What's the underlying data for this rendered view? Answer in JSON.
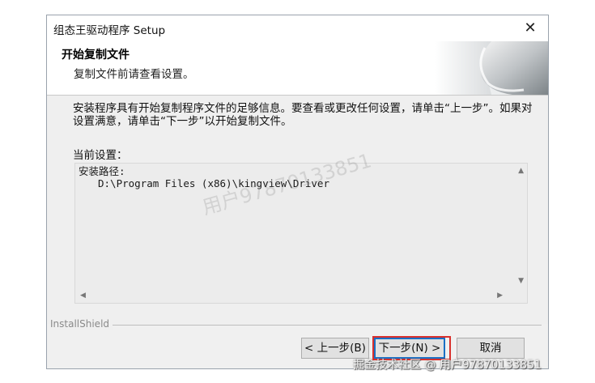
{
  "window": {
    "title": "组态王驱动程序 Setup",
    "close_glyph": "✕"
  },
  "header": {
    "title": "开始复制文件",
    "subtitle": "复制文件前请查看设置。"
  },
  "body": {
    "description": "安装程序具有开始复制程序文件的足够信息。要查看或更改任何设置，请单击“上一步”。如果对设置满意，请单击“下一步”以开始复制文件。",
    "current_label": "当前设置：",
    "settings_lines": [
      "安装路径:",
      "D:\\Program Files (x86)\\kingview\\Driver"
    ]
  },
  "footer": {
    "brand": "InstallShield"
  },
  "buttons": {
    "back": "< 上一步(B)",
    "next": "下一步(N) >",
    "cancel": "取消"
  },
  "watermarks": {
    "center": "用户97870133851",
    "footer": "掘金技术社区 @ 用户97870133851"
  },
  "colors": {
    "highlight": "#d9302c",
    "default_button_border": "#1a6fc4"
  }
}
